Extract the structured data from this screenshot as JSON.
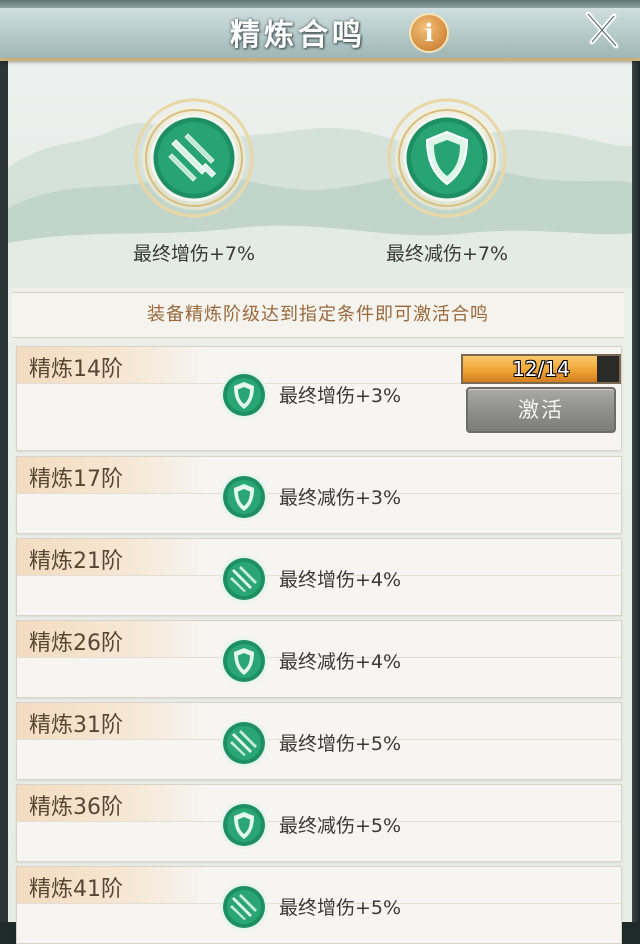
{
  "window": {
    "title": "精炼合鸣",
    "info_label": "i"
  },
  "summary": {
    "attack_label": "最终增伤+7%",
    "defense_label": "最终减伤+7%"
  },
  "notice": "装备精炼阶级达到指定条件即可激活合鸣",
  "rows": [
    {
      "tier": "精炼14阶",
      "icon": "shield-icon",
      "bonus": "最终增伤+3%"
    },
    {
      "tier": "精炼17阶",
      "icon": "shield-icon",
      "bonus": "最终减伤+3%"
    },
    {
      "tier": "精炼21阶",
      "icon": "sword-icon",
      "bonus": "最终增伤+4%"
    },
    {
      "tier": "精炼26阶",
      "icon": "shield-icon",
      "bonus": "最终减伤+4%"
    },
    {
      "tier": "精炼31阶",
      "icon": "sword-icon",
      "bonus": "最终增伤+5%"
    },
    {
      "tier": "精炼36阶",
      "icon": "shield-icon",
      "bonus": "最终减伤+5%"
    },
    {
      "tier": "精炼41阶",
      "icon": "sword-icon",
      "bonus": "最终增伤+5%"
    }
  ],
  "progress": {
    "text": "12/14",
    "fraction": 0.857
  },
  "activate_label": "激活",
  "colors": {
    "medal_green": "#1f8f63",
    "tier_text": "#5a4635",
    "notice_text": "#9a6a3c",
    "progress_fill": "#eea030"
  }
}
